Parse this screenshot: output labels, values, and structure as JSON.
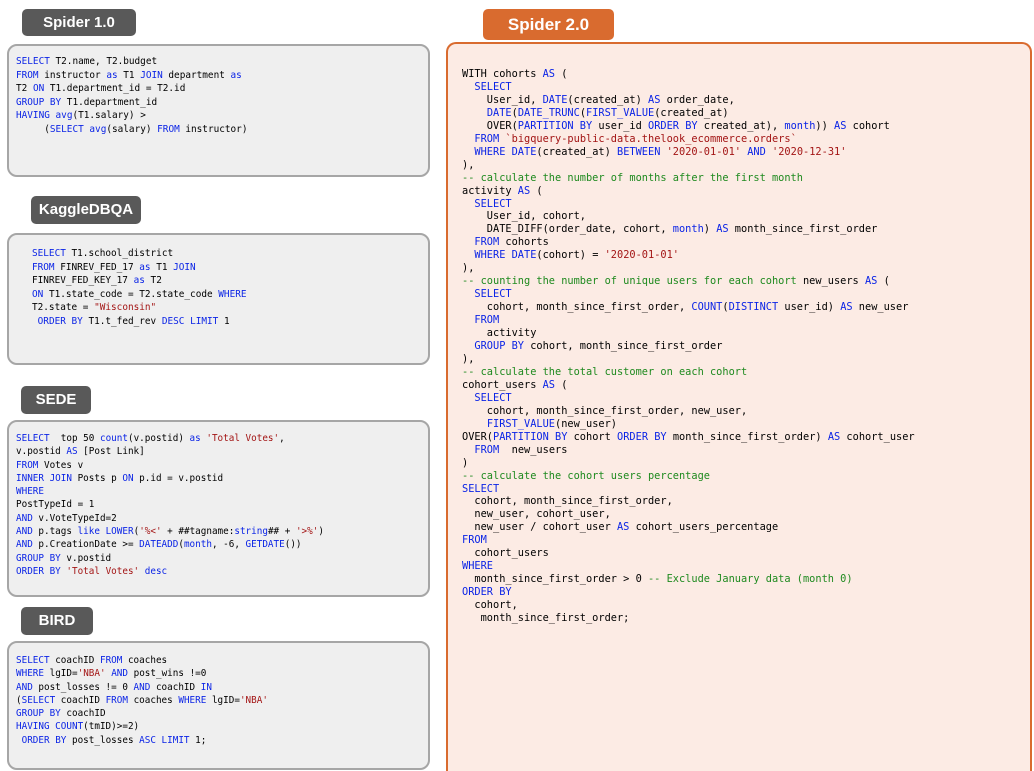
{
  "datasets": [
    {
      "name": "Spider 1.0",
      "lines": [
        [
          [
            "kw",
            "SELECT"
          ],
          [
            "t",
            " T2.name, T2.budget"
          ]
        ],
        [
          [
            "kw",
            "FROM"
          ],
          [
            "t",
            " instructor "
          ],
          [
            "kw",
            "as"
          ],
          [
            "t",
            " T1 "
          ],
          [
            "kw",
            "JOIN"
          ],
          [
            "t",
            " department "
          ],
          [
            "kw",
            "as"
          ]
        ],
        [
          [
            "t",
            "T2 "
          ],
          [
            "kw",
            "ON"
          ],
          [
            "t",
            " T1.department_id = T2.id"
          ]
        ],
        [
          [
            "kw",
            "GROUP BY"
          ],
          [
            "t",
            " T1.department_id"
          ]
        ],
        [
          [
            "kw",
            "HAVING"
          ],
          [
            "t",
            " "
          ],
          [
            "kw",
            "avg"
          ],
          [
            "t",
            "(T1.salary) >"
          ]
        ],
        [
          [
            "t",
            "     ("
          ],
          [
            "kw",
            "SELECT"
          ],
          [
            "t",
            " "
          ],
          [
            "kw",
            "avg"
          ],
          [
            "t",
            "(salary) "
          ],
          [
            "kw",
            "FROM"
          ],
          [
            "t",
            " instructor)"
          ]
        ]
      ]
    },
    {
      "name": "KaggleDBQA",
      "lines": [
        [
          [
            "kw",
            "SELECT"
          ],
          [
            "t",
            " T1.school_district"
          ]
        ],
        [
          [
            "kw",
            "FROM"
          ],
          [
            "t",
            " FINREV_FED_17 "
          ],
          [
            "kw",
            "as"
          ],
          [
            "t",
            " T1 "
          ],
          [
            "kw",
            "JOIN"
          ]
        ],
        [
          [
            "t",
            "FINREV_FED_KEY_17 "
          ],
          [
            "kw",
            "as"
          ],
          [
            "t",
            " T2"
          ]
        ],
        [
          [
            "kw",
            "ON"
          ],
          [
            "t",
            " T1.state_code = T2.state_code "
          ],
          [
            "kw",
            "WHERE"
          ]
        ],
        [
          [
            "t",
            "T2.state = "
          ],
          [
            "str",
            "\"Wisconsin\""
          ]
        ],
        [
          [
            "t",
            " "
          ],
          [
            "kw",
            "ORDER BY"
          ],
          [
            "t",
            " T1.t_fed_rev "
          ],
          [
            "kw",
            "DESC LIMIT"
          ],
          [
            "t",
            " 1"
          ]
        ]
      ]
    },
    {
      "name": "SEDE",
      "lines": [
        [
          [
            "kw",
            "SELECT"
          ],
          [
            "t",
            "  top 50 "
          ],
          [
            "kw",
            "count"
          ],
          [
            "t",
            "(v.postid) "
          ],
          [
            "kw",
            "as"
          ],
          [
            "t",
            " "
          ],
          [
            "str",
            "'Total Votes'"
          ],
          [
            "t",
            ","
          ]
        ],
        [
          [
            "t",
            "v.postid "
          ],
          [
            "kw",
            "AS"
          ],
          [
            "t",
            " [Post Link]"
          ]
        ],
        [
          [
            "kw",
            "FROM"
          ],
          [
            "t",
            " Votes v"
          ]
        ],
        [
          [
            "kw",
            "INNER JOIN"
          ],
          [
            "t",
            " Posts p "
          ],
          [
            "kw",
            "ON"
          ],
          [
            "t",
            " p.id = v.postid"
          ]
        ],
        [
          [
            "kw",
            "WHERE"
          ]
        ],
        [
          [
            "t",
            "PostTypeId = 1"
          ]
        ],
        [
          [
            "kw",
            "AND"
          ],
          [
            "t",
            " v.VoteTypeId=2"
          ]
        ],
        [
          [
            "kw",
            "AND"
          ],
          [
            "t",
            " p.tags "
          ],
          [
            "kw",
            "like"
          ],
          [
            "t",
            " "
          ],
          [
            "kw",
            "LOWER"
          ],
          [
            "t",
            "("
          ],
          [
            "str",
            "'%<'"
          ],
          [
            "t",
            " + ##tagname:"
          ],
          [
            "kw",
            "string"
          ],
          [
            "t",
            "## + "
          ],
          [
            "str",
            "'>%'"
          ],
          [
            "t",
            ")"
          ]
        ],
        [
          [
            "kw",
            "AND"
          ],
          [
            "t",
            " p.CreationDate >= "
          ],
          [
            "kw",
            "DATEADD"
          ],
          [
            "t",
            "("
          ],
          [
            "kw",
            "month"
          ],
          [
            "t",
            ", -6, "
          ],
          [
            "kw",
            "GETDATE"
          ],
          [
            "t",
            "())"
          ]
        ],
        [
          [
            "kw",
            "GROUP BY"
          ],
          [
            "t",
            " v.postid"
          ]
        ],
        [
          [
            "kw",
            "ORDER BY"
          ],
          [
            "t",
            " "
          ],
          [
            "str",
            "'Total Votes'"
          ],
          [
            "t",
            " "
          ],
          [
            "kw",
            "desc"
          ]
        ]
      ]
    },
    {
      "name": "BIRD",
      "lines": [
        [
          [
            "kw",
            "SELECT"
          ],
          [
            "t",
            " coachID "
          ],
          [
            "kw",
            "FROM"
          ],
          [
            "t",
            " coaches"
          ]
        ],
        [
          [
            "kw",
            "WHERE"
          ],
          [
            "t",
            " lgID="
          ],
          [
            "str",
            "'NBA'"
          ],
          [
            "t",
            " "
          ],
          [
            "kw",
            "AND"
          ],
          [
            "t",
            " post_wins !=0"
          ]
        ],
        [
          [
            "kw",
            "AND"
          ],
          [
            "t",
            " post_losses != 0 "
          ],
          [
            "kw",
            "AND"
          ],
          [
            "t",
            " coachID "
          ],
          [
            "kw",
            "IN"
          ]
        ],
        [
          [
            "t",
            "("
          ],
          [
            "kw",
            "SELECT"
          ],
          [
            "t",
            " coachID "
          ],
          [
            "kw",
            "FROM"
          ],
          [
            "t",
            " coaches "
          ],
          [
            "kw",
            "WHERE"
          ],
          [
            "t",
            " lgID="
          ],
          [
            "str",
            "'NBA'"
          ]
        ],
        [
          [
            "kw",
            "GROUP BY"
          ],
          [
            "t",
            " coachID"
          ]
        ],
        [
          [
            "kw",
            "HAVING COUNT"
          ],
          [
            "t",
            "(tmID)>=2)"
          ]
        ],
        [
          [
            "t",
            " "
          ],
          [
            "kw",
            "ORDER BY"
          ],
          [
            "t",
            " post_losses "
          ],
          [
            "kw",
            "ASC LIMIT"
          ],
          [
            "t",
            " 1;"
          ]
        ]
      ]
    }
  ],
  "spider2": {
    "name": "Spider 2.0",
    "lines": [
      [
        [
          "t",
          "WITH cohorts "
        ],
        [
          "kw",
          "AS"
        ],
        [
          "t",
          " ("
        ]
      ],
      [
        [
          "t",
          "  "
        ],
        [
          "kw",
          "SELECT"
        ]
      ],
      [
        [
          "t",
          "    User_id, "
        ],
        [
          "kw",
          "DATE"
        ],
        [
          "t",
          "(created_at) "
        ],
        [
          "kw",
          "AS"
        ],
        [
          "t",
          " order_date,"
        ]
      ],
      [
        [
          "t",
          "    "
        ],
        [
          "kw",
          "DATE"
        ],
        [
          "t",
          "("
        ],
        [
          "kw",
          "DATE_TRUNC"
        ],
        [
          "t",
          "("
        ],
        [
          "kw",
          "FIRST_VALUE"
        ],
        [
          "t",
          "(created_at)"
        ]
      ],
      [
        [
          "t",
          "    OVER("
        ],
        [
          "kw",
          "PARTITION BY"
        ],
        [
          "t",
          " user_id "
        ],
        [
          "kw",
          "ORDER BY"
        ],
        [
          "t",
          " created_at), "
        ],
        [
          "kw",
          "month"
        ],
        [
          "t",
          ")) "
        ],
        [
          "kw",
          "AS"
        ],
        [
          "t",
          " cohort"
        ]
      ],
      [
        [
          "t",
          "  "
        ],
        [
          "kw",
          "FROM"
        ],
        [
          "t",
          " "
        ],
        [
          "str",
          "`bigquery-public-data.thelook_ecommerce.orders`"
        ]
      ],
      [
        [
          "t",
          "  "
        ],
        [
          "kw",
          "WHERE DATE"
        ],
        [
          "t",
          "(created_at) "
        ],
        [
          "kw",
          "BETWEEN"
        ],
        [
          "t",
          " "
        ],
        [
          "str",
          "'2020-01-01'"
        ],
        [
          "t",
          " "
        ],
        [
          "kw",
          "AND"
        ],
        [
          "t",
          " "
        ],
        [
          "str",
          "'2020-12-31'"
        ]
      ],
      [
        [
          "t",
          "),"
        ]
      ],
      [
        [
          "cm",
          "-- calculate the number of months after the first month"
        ]
      ],
      [
        [
          "t",
          "activity "
        ],
        [
          "kw",
          "AS"
        ],
        [
          "t",
          " ("
        ]
      ],
      [
        [
          "t",
          "  "
        ],
        [
          "kw",
          "SELECT"
        ]
      ],
      [
        [
          "t",
          "    User_id, cohort,"
        ]
      ],
      [
        [
          "t",
          "    DATE_DIFF(order_date, cohort, "
        ],
        [
          "kw",
          "month"
        ],
        [
          "t",
          ") "
        ],
        [
          "kw",
          "AS"
        ],
        [
          "t",
          " month_since_first_order"
        ]
      ],
      [
        [
          "t",
          "  "
        ],
        [
          "kw",
          "FROM"
        ],
        [
          "t",
          " cohorts"
        ]
      ],
      [
        [
          "t",
          "  "
        ],
        [
          "kw",
          "WHERE DATE"
        ],
        [
          "t",
          "(cohort) = "
        ],
        [
          "str",
          "'2020-01-01'"
        ]
      ],
      [
        [
          "t",
          "),"
        ]
      ],
      [
        [
          "cm",
          "-- counting the number of unique users for each cohort"
        ],
        [
          "t",
          " new_users "
        ],
        [
          "kw",
          "AS"
        ],
        [
          "t",
          " ("
        ]
      ],
      [
        [
          "t",
          "  "
        ],
        [
          "kw",
          "SELECT"
        ]
      ],
      [
        [
          "t",
          "    cohort, month_since_first_order, "
        ],
        [
          "kw",
          "COUNT"
        ],
        [
          "t",
          "("
        ],
        [
          "kw",
          "DISTINCT"
        ],
        [
          "t",
          " user_id) "
        ],
        [
          "kw",
          "AS"
        ],
        [
          "t",
          " new_user"
        ]
      ],
      [
        [
          "t",
          "  "
        ],
        [
          "kw",
          "FROM"
        ]
      ],
      [
        [
          "t",
          "    activity"
        ]
      ],
      [
        [
          "t",
          "  "
        ],
        [
          "kw",
          "GROUP BY"
        ],
        [
          "t",
          " cohort, month_since_first_order"
        ]
      ],
      [
        [
          "t",
          "),"
        ]
      ],
      [
        [
          "cm",
          "-- calculate the total customer on each cohort"
        ]
      ],
      [
        [
          "t",
          "cohort_users "
        ],
        [
          "kw",
          "AS"
        ],
        [
          "t",
          " ("
        ]
      ],
      [
        [
          "t",
          "  "
        ],
        [
          "kw",
          "SELECT"
        ]
      ],
      [
        [
          "t",
          "    cohort, month_since_first_order, new_user,"
        ]
      ],
      [
        [
          "t",
          "    "
        ],
        [
          "kw",
          "FIRST_VALUE"
        ],
        [
          "t",
          "(new_user)"
        ]
      ],
      [
        [
          "t",
          "OVER("
        ],
        [
          "kw",
          "PARTITION BY"
        ],
        [
          "t",
          " cohort "
        ],
        [
          "kw",
          "ORDER BY"
        ],
        [
          "t",
          " month_since_first_order) "
        ],
        [
          "kw",
          "AS"
        ],
        [
          "t",
          " cohort_user"
        ]
      ],
      [
        [
          "t",
          "  "
        ],
        [
          "kw",
          "FROM"
        ],
        [
          "t",
          "  new_users"
        ]
      ],
      [
        [
          "t",
          ")"
        ]
      ],
      [
        [
          "cm",
          "-- calculate the cohort users percentage"
        ]
      ],
      [
        [
          "kw",
          "SELECT"
        ]
      ],
      [
        [
          "t",
          "  cohort, month_since_first_order,"
        ]
      ],
      [
        [
          "t",
          "  new_user, cohort_user,"
        ]
      ],
      [
        [
          "t",
          "  new_user / cohort_user "
        ],
        [
          "kw",
          "AS"
        ],
        [
          "t",
          " cohort_users_percentage"
        ]
      ],
      [
        [
          "kw",
          "FROM"
        ]
      ],
      [
        [
          "t",
          "  cohort_users"
        ]
      ],
      [
        [
          "kw",
          "WHERE"
        ]
      ],
      [
        [
          "t",
          "  month_since_first_order > 0 "
        ],
        [
          "cm",
          "-- Exclude January data (month 0)"
        ]
      ],
      [
        [
          "kw",
          "ORDER BY"
        ]
      ],
      [
        [
          "t",
          "  cohort,"
        ]
      ],
      [
        [
          "t",
          "   month_since_first_order;"
        ]
      ]
    ]
  }
}
